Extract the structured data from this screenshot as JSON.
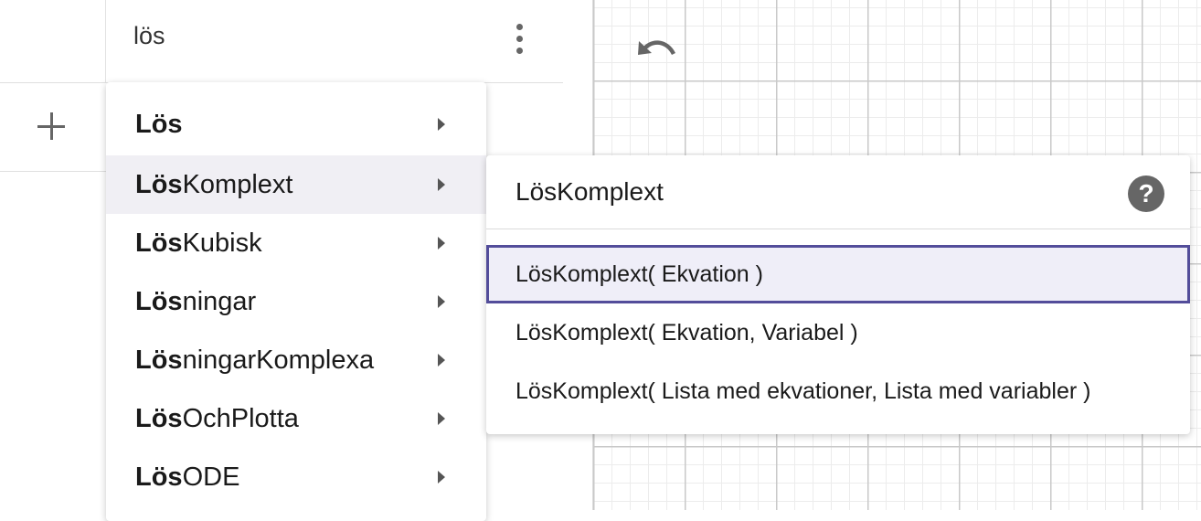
{
  "algebra": {
    "input_value": "lös"
  },
  "suggestions": {
    "bold_prefix": "Lös",
    "items": [
      {
        "prefix": "Lös",
        "rest": ""
      },
      {
        "prefix": "Lös",
        "rest": "Komplext"
      },
      {
        "prefix": "Lös",
        "rest": "Kubisk"
      },
      {
        "prefix": "Lös",
        "rest": "ningar"
      },
      {
        "prefix": "Lös",
        "rest": "ningarKomplexa"
      },
      {
        "prefix": "Lös",
        "rest": "OchPlotta"
      },
      {
        "prefix": "Lös",
        "rest": "ODE"
      }
    ],
    "selected_index": 1
  },
  "submenu": {
    "title": "LösKomplext",
    "help_icon": "?",
    "syntaxes": [
      "LösKomplext( Ekvation )",
      "LösKomplext( Ekvation, Variabel )",
      "LösKomplext( Lista med ekvationer, Lista med variabler )"
    ]
  },
  "icons": {
    "undo": "undo-icon",
    "more": "more-vert-icon",
    "add": "plus-icon",
    "help": "help-icon",
    "submenu_arrow": "arrow-right-icon"
  },
  "colors": {
    "selection_border": "#534d9a",
    "selection_bg": "#efeef8",
    "menu_hover_bg": "#f0eff4",
    "icon_gray": "#666666"
  }
}
